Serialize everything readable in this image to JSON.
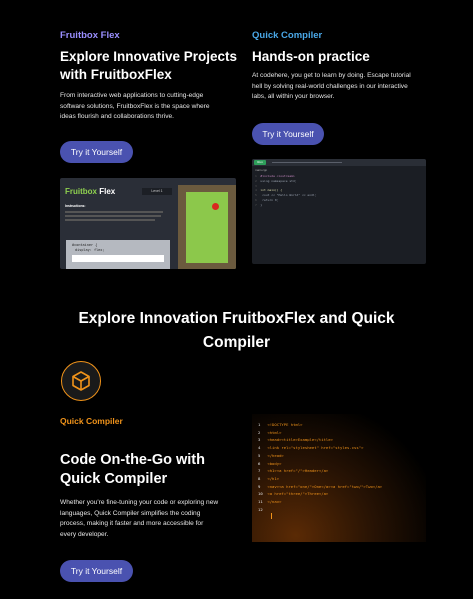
{
  "card1": {
    "eyebrow": "Fruitbox Flex",
    "title_l1": "Explore Innovative Projects",
    "title_l2": "with FruitboxFlex",
    "desc_l1": "From interactive web applications to cutting-edge",
    "desc_l2": "software solutions, FruitboxFlex is the space where",
    "desc_l3": "ideas flourish and collaborations thrive.",
    "button": "Try it Yourself",
    "shot": {
      "logo_a": "Fruitbox",
      "logo_b": "Flex",
      "level": "Level 1",
      "instructions_label": "Instructions:",
      "code_l1": "#container {",
      "code_l2": "display: flex;"
    }
  },
  "card2": {
    "eyebrow": "Quick Compiler",
    "title": "Hands-on practice",
    "desc_l1": "At codehere, you get to learn by doing. Escape tutorial",
    "desc_l2": "hell by solving real-world challenges in our interactive",
    "desc_l3": "labs, all within your browser.",
    "button": "Try it Yourself",
    "shot": {
      "run": "Run",
      "file": "main.cpp",
      "code": [
        "#include <iostream>",
        "using namespace std;",
        "",
        "int main() {",
        "  cout << \"Hello World\" << endl;",
        "  return 0;",
        "}"
      ]
    }
  },
  "section": {
    "title_l1": "Explore Innovation FruitboxFlex and Quick",
    "title_l2": "Compiler"
  },
  "feature": {
    "icon": "cube-icon",
    "eyebrow": "Quick Compiler",
    "title_l1": "Code On-the-Go with",
    "title_l2": "Quick Compiler",
    "desc_l1": "Whether you're fine-tuning your code or exploring new",
    "desc_l2": "languages, Quick Compiler simplifies the coding",
    "desc_l3": "process, making it faster and more accessible for",
    "desc_l4": "every developer.",
    "button": "Try it Yourself",
    "code_lines": [
      "<!DOCTYPE html>",
      "<html>",
      "<head><title>Example</title>",
      "<link rel=\"stylesheet\" href=\"styles.css\">",
      "</head>",
      "<body>",
      "<h1><a href=\"/\">Header</a>",
      "</h1>",
      "<nav><a href=\"one/\">One</a><a href=\"two/\">Two</a>",
      "<a href=\"three/\">Three</a>",
      "</nav>"
    ]
  },
  "colors": {
    "card1_accent": "#9a8fff",
    "card2_accent": "#4aa8e8",
    "feature_accent": "#f0931a",
    "button_bg": "#4a52b0"
  }
}
